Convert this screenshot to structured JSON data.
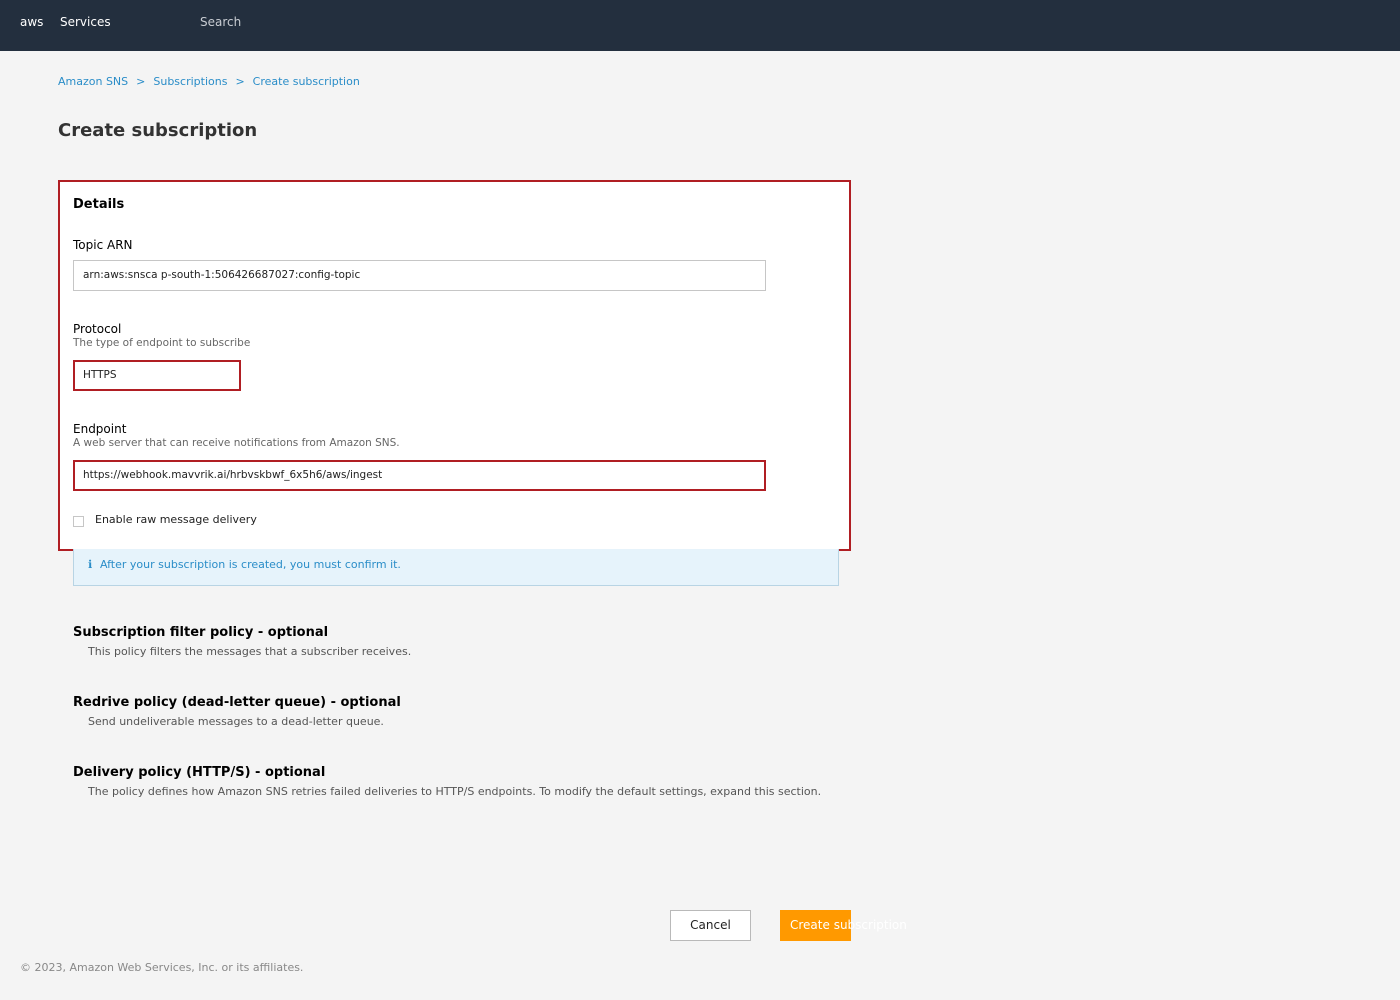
{
  "header": {
    "logo": "aws",
    "services": "Services",
    "search_placeholder": "Search"
  },
  "breadcrumb": {
    "items": [
      "Amazon SNS",
      "Subscriptions",
      "Create subscription"
    ],
    "separator": ">"
  },
  "page_title": "Create subscription",
  "details": {
    "title": "Details",
    "topic_arn": {
      "label": "Topic ARN",
      "value": "arn:aws:snsca p-south-1:506426687027:config-topic"
    },
    "protocol": {
      "label": "Protocol",
      "description": "The type of endpoint to subscribe",
      "value": "HTTPS"
    },
    "endpoint": {
      "label": "Endpoint",
      "description": "A web server that can receive notifications from Amazon SNS.",
      "value": "https://webhook.mavvrik.ai/hrbvskbwf_6x5h6/aws/ingest"
    },
    "raw_delivery": {
      "label": "Enable raw message delivery",
      "checked": false
    }
  },
  "info": {
    "icon": "info-icon",
    "icon_glyph": "ℹ",
    "text": "After your subscription is created, you must confirm it."
  },
  "sections": [
    {
      "title": "Subscription filter policy - optional",
      "description": "This policy filters the messages that a subscriber receives."
    },
    {
      "title": "Redrive policy (dead-letter queue) - optional",
      "description": "Send undeliverable messages to a dead-letter queue."
    },
    {
      "title": "Delivery policy (HTTP/S) - optional",
      "description": "The policy defines how Amazon SNS retries failed deliveries to HTTP/S endpoints. To modify the default settings, expand this section."
    }
  ],
  "actions": {
    "cancel": "Cancel",
    "create": "Create subscription"
  },
  "footer": "© 2023, Amazon Web Services, Inc. or its affiliates.",
  "colors": {
    "topbar": "#232f3e",
    "error_border": "#b01e23",
    "link": "#2a8dc8",
    "primary_button": "#ff9900",
    "info_background": "#e6f3fb"
  }
}
